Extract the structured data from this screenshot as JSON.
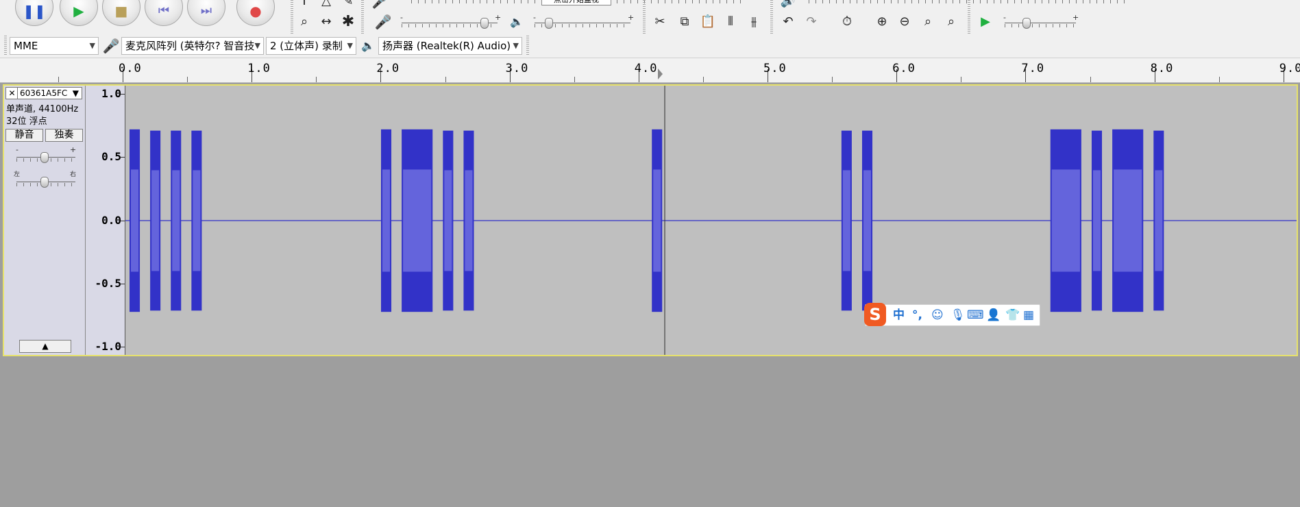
{
  "transport": {
    "pause": "pause-icon",
    "play": "play-icon",
    "stop": "stop-icon",
    "skip_start": "skip-to-start-icon",
    "skip_end": "skip-to-end-icon",
    "record": "record-icon",
    "record_color": "#e04848",
    "play_color": "#20b040"
  },
  "meters": {
    "plus": "+",
    "minus": "-",
    "tooltip_fragment": "点击开始监视"
  },
  "device": {
    "host": "MME",
    "input_device": "麦克风阵列 (英特尔? 智音技",
    "channels": "2 (立体声) 录制",
    "output_device": "扬声器 (Realtek(R) Audio)"
  },
  "ruler": {
    "labels": [
      "0.0",
      "1.0",
      "2.0",
      "3.0",
      "4.0",
      "5.0",
      "6.0",
      "7.0",
      "8.0",
      "9.0"
    ]
  },
  "track": {
    "name": "60361A5FC",
    "info1": "单声道, 44100Hz",
    "info2": "32位 浮点",
    "mute": "静音",
    "solo": "独奏",
    "gain_minus": "-",
    "gain_plus": "+",
    "pan_left": "左",
    "pan_right": "右",
    "vruler": [
      "1.0",
      "0.5",
      "0.0",
      "-0.5",
      "-1.0"
    ],
    "wave_color": "#3232c8",
    "wave_fill": "#6464dc",
    "cursor_time": 4.15,
    "bursts": [
      {
        "start": 0.0,
        "end": 0.08,
        "amp": 0.72
      },
      {
        "start": 0.16,
        "end": 0.24,
        "amp": 0.71
      },
      {
        "start": 0.32,
        "end": 0.4,
        "amp": 0.71
      },
      {
        "start": 0.48,
        "end": 0.56,
        "amp": 0.71
      },
      {
        "start": 1.95,
        "end": 2.03,
        "amp": 0.72
      },
      {
        "start": 2.11,
        "end": 2.35,
        "amp": 0.72
      },
      {
        "start": 2.43,
        "end": 2.51,
        "amp": 0.71
      },
      {
        "start": 2.59,
        "end": 2.67,
        "amp": 0.71
      },
      {
        "start": 4.05,
        "end": 4.13,
        "amp": 0.72
      },
      {
        "start": 5.52,
        "end": 5.6,
        "amp": 0.71
      },
      {
        "start": 5.68,
        "end": 5.76,
        "amp": 0.71
      },
      {
        "start": 7.14,
        "end": 7.38,
        "amp": 0.72
      },
      {
        "start": 7.46,
        "end": 7.54,
        "amp": 0.71
      },
      {
        "start": 7.62,
        "end": 7.86,
        "amp": 0.72
      },
      {
        "start": 7.94,
        "end": 8.02,
        "amp": 0.71
      }
    ]
  },
  "ime": {
    "logo": "S",
    "mode": "中",
    "punct": "°,",
    "icons": [
      "emoji-icon",
      "microphone-icon",
      "keyboard-icon",
      "user-icon",
      "shirt-icon",
      "grid-icon"
    ]
  }
}
